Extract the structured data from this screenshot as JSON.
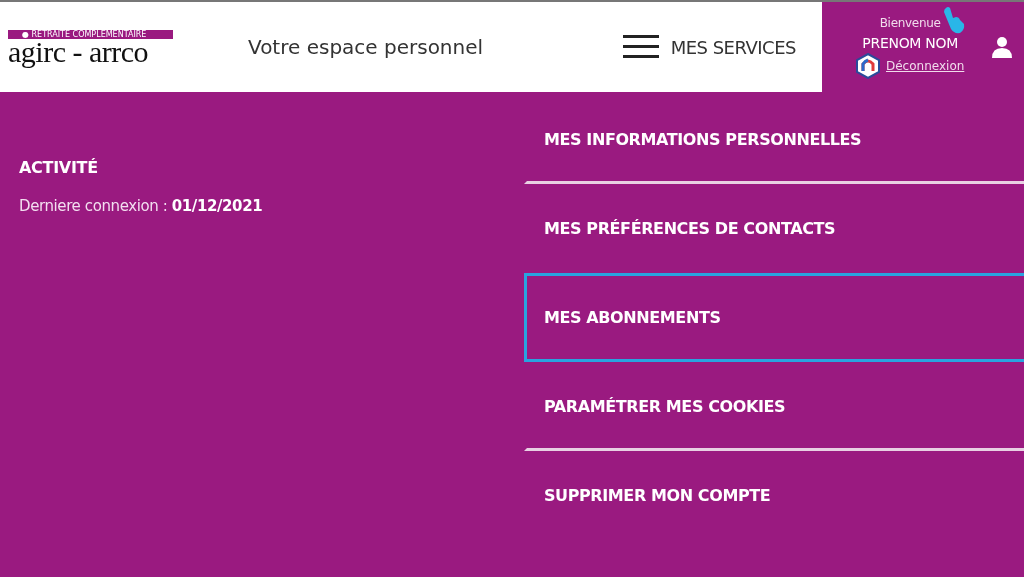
{
  "header": {
    "logo": {
      "tagline": "● RETRAITE COMPLEMENTAIRE",
      "wordmark": "agirc - arrco"
    },
    "title": "Votre espace personnel",
    "menu_button": "MES SERVICES",
    "user": {
      "greeting": "Bienvenue",
      "name": "PRENOM NOM",
      "logout": "Déconnexion"
    }
  },
  "activity": {
    "heading": "ACTIVITÉ",
    "last_login": "Derniere connexion : **01/12/2021**"
  },
  "menu": [
    {
      "label": "MES INFORMATIONS PERSONNELLES",
      "selected": false
    },
    {
      "label": "MES PRÉFÉRENCES DE CONTACTS",
      "selected": false
    },
    {
      "label": "MES ABONNEMENTS",
      "selected": true
    },
    {
      "label": "PARAMÉTRER MES COOKIES",
      "selected": false
    },
    {
      "label": "SUPPRIMER MON COMPTE",
      "selected": false
    }
  ]
}
